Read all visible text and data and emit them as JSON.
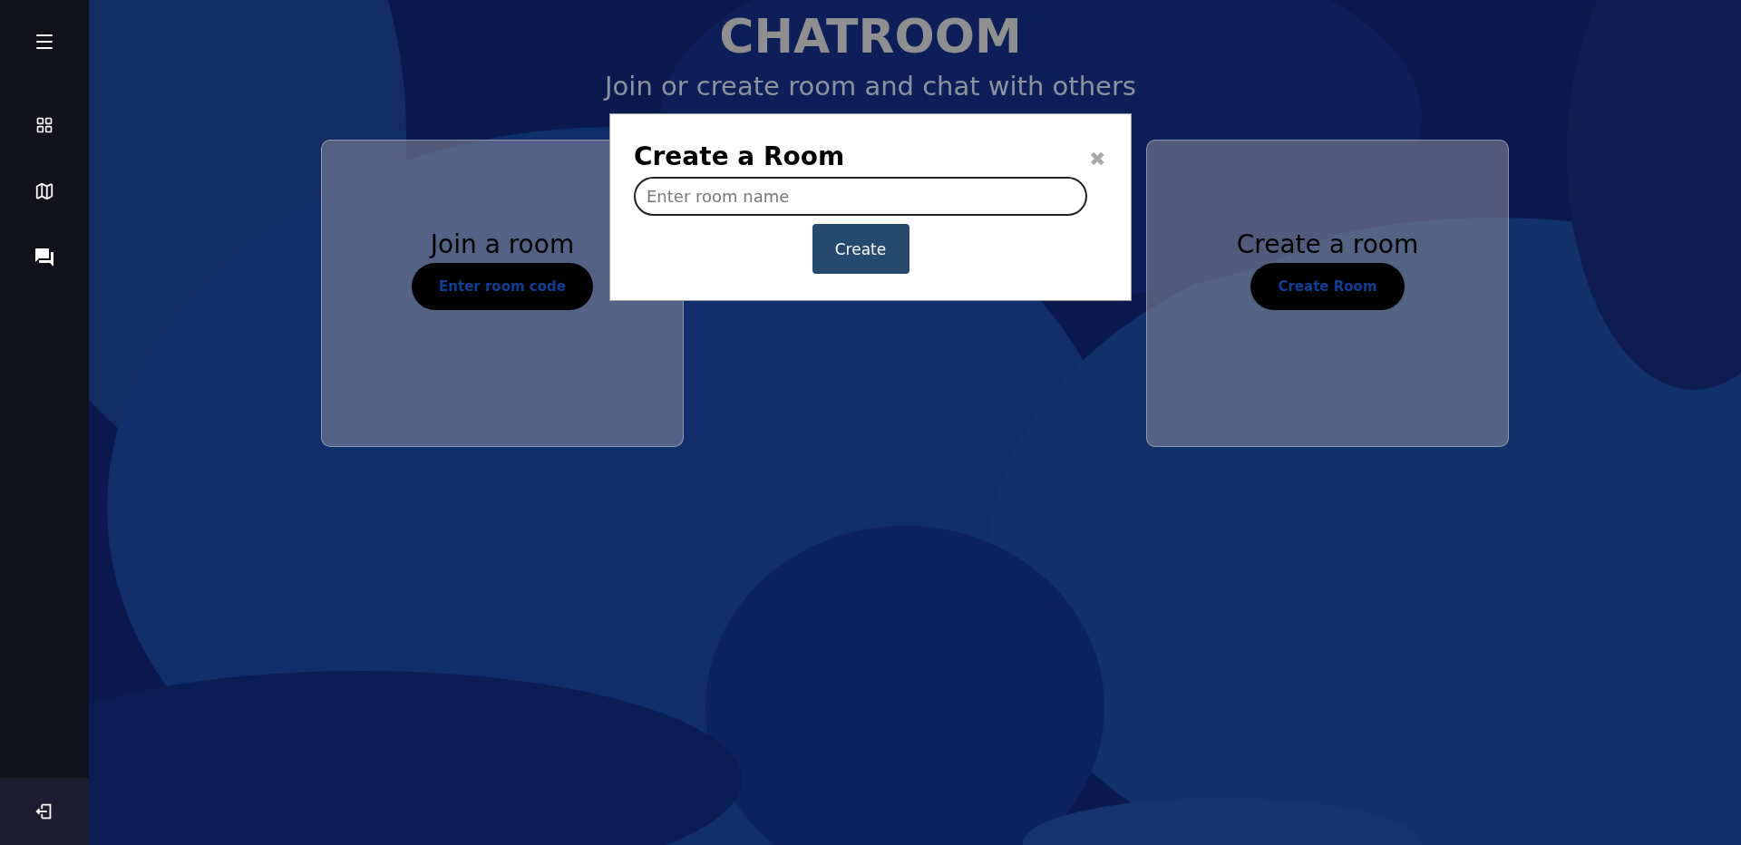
{
  "header": {
    "title": "CHATROOM",
    "subtitle": "Join or create room and chat with others"
  },
  "cards": [
    {
      "heading": "Join a room",
      "button": "Enter room code"
    },
    {
      "heading": "Create a room",
      "button": "Create Room"
    }
  ],
  "modal": {
    "title": "Create a Room",
    "close": "✖",
    "input": {
      "placeholder": "Enter room name"
    },
    "button": "Create"
  }
}
